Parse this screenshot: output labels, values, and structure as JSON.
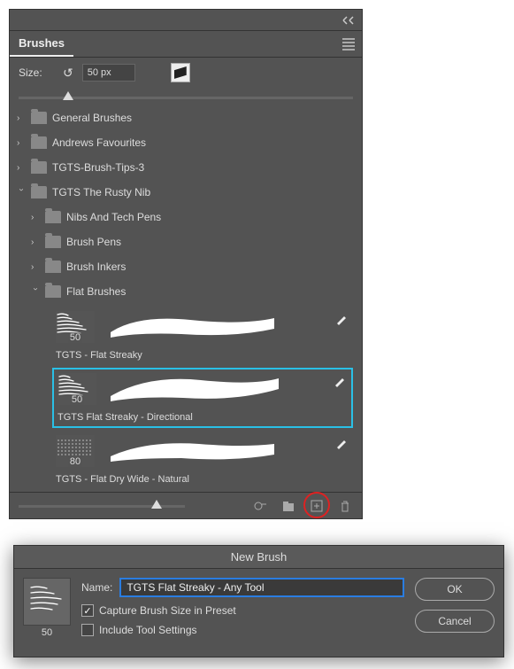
{
  "panel": {
    "title": "Brushes",
    "size_label": "Size:",
    "size_value": "50 px"
  },
  "folders": {
    "general": "General Brushes",
    "favourites": "Andrews Favourites",
    "tips3": "TGTS-Brush-Tips-3",
    "rusty": "TGTS The Rusty Nib",
    "nibs": "Nibs And Tech Pens",
    "brushpens": "Brush Pens",
    "inkers": "Brush Inkers",
    "flat": "Flat Brushes"
  },
  "brushes": {
    "b1": {
      "size": "50",
      "name": "TGTS - Flat Streaky"
    },
    "b2": {
      "size": "50",
      "name": "TGTS Flat Streaky  - Directional"
    },
    "b3": {
      "size": "80",
      "name": "TGTS - Flat Dry Wide - Natural"
    }
  },
  "dialog": {
    "title": "New Brush",
    "name_label": "Name:",
    "name_value": "TGTS Flat Streaky - Any Tool",
    "thumb_size": "50",
    "capture": "Capture Brush Size in Preset",
    "include": "Include Tool Settings",
    "ok": "OK",
    "cancel": "Cancel"
  }
}
